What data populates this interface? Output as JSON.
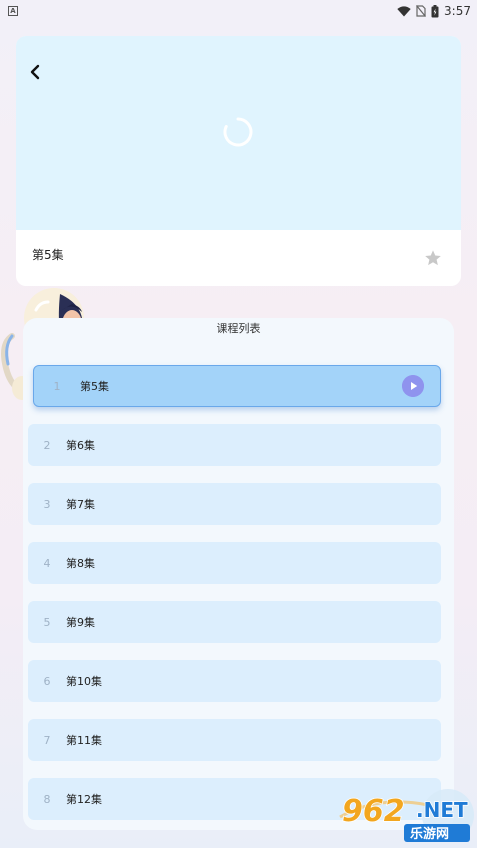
{
  "status_bar": {
    "notification_glyph": "A",
    "time": "3:57",
    "icons": [
      "wifi-icon",
      "no-sim-icon",
      "battery-icon"
    ]
  },
  "player": {
    "episode_title": "第5集",
    "icons": [
      "back-icon",
      "loading-spinner",
      "star-icon"
    ],
    "colors": {
      "video_bg": "#e0f4fe",
      "spinner": "#ffffff",
      "star": "#c8c8c8"
    }
  },
  "course_list": {
    "title": "课程列表",
    "items": [
      {
        "index": "1",
        "name": "第5集",
        "active": true
      },
      {
        "index": "2",
        "name": "第6集",
        "active": false
      },
      {
        "index": "3",
        "name": "第7集",
        "active": false
      },
      {
        "index": "4",
        "name": "第8集",
        "active": false
      },
      {
        "index": "5",
        "name": "第9集",
        "active": false
      },
      {
        "index": "6",
        "name": "第10集",
        "active": false
      },
      {
        "index": "7",
        "name": "第11集",
        "active": false
      },
      {
        "index": "8",
        "name": "第12集",
        "active": false
      }
    ],
    "colors": {
      "row_bg": "#dceefd",
      "active_row_bg": "#a3d3f9",
      "play_button": "#8f93ee"
    }
  },
  "watermark": {
    "number_text": "962",
    "suffix_text": ".NET",
    "site_text": "乐游网"
  }
}
